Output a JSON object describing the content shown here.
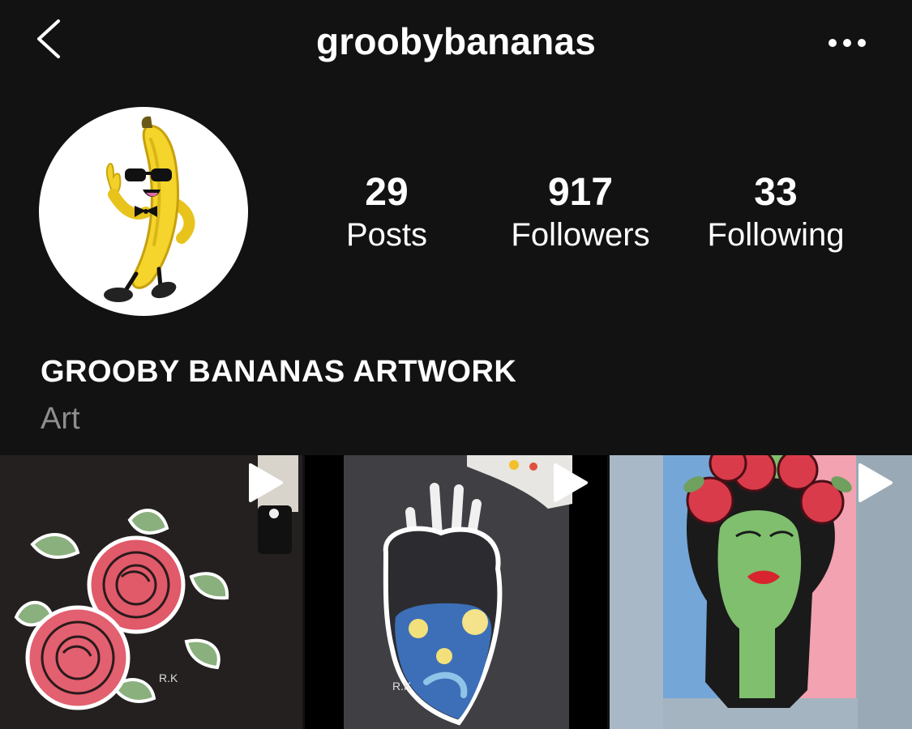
{
  "header": {
    "username": "groobybananas",
    "back_icon": "chevron-left-icon",
    "more_icon": "more-horizontal-icon"
  },
  "profile": {
    "avatar": "banana-mascot-avatar",
    "stats": [
      {
        "value": "29",
        "label": "Posts"
      },
      {
        "value": "917",
        "label": "Followers"
      },
      {
        "value": "33",
        "label": "Following"
      }
    ],
    "display_name": "GROOBY BANANAS ARTWORK",
    "category": "Art"
  },
  "grid": {
    "posts": [
      {
        "type": "video",
        "subject": "pink-roses-painted-denim-jacket"
      },
      {
        "type": "video",
        "subject": "anatomical-heart-starry-night-jacket"
      },
      {
        "type": "video",
        "subject": "woman-with-roses-portrait-jacket"
      }
    ]
  },
  "colors": {
    "background": "#121212",
    "text": "#ffffff",
    "secondary_text": "#8e8e8e"
  }
}
